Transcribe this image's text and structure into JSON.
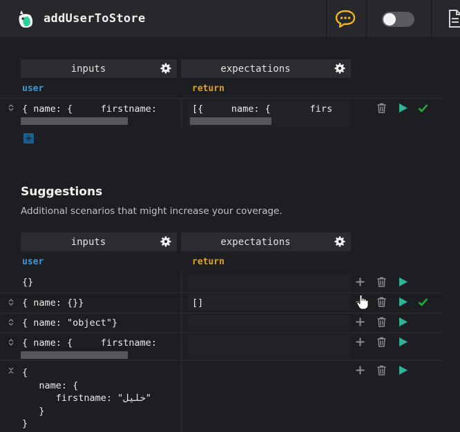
{
  "header": {
    "title": "addUserToStore",
    "icons": [
      "logo-icon",
      "chat-icon",
      "toggle-switch",
      "document-icon"
    ]
  },
  "test": {
    "inputs_label": "inputs",
    "expectations_label": "expectations",
    "input_name": "user",
    "output_name": "return",
    "input_value": "{ name: {     firstname:",
    "output_value": "[{     name: {       firs"
  },
  "suggestions": {
    "title": "Suggestions",
    "subtitle": "Additional scenarios that might increase your coverage.",
    "inputs_label": "inputs",
    "expectations_label": "expectations",
    "input_name": "user",
    "output_name": "return",
    "rows": [
      {
        "input": "{}",
        "output": ""
      },
      {
        "input": "{ name: {}}",
        "output": "[]"
      },
      {
        "input": "{ name: \"object\"}",
        "output": ""
      },
      {
        "input": "{ name: {     firstname:",
        "output": ""
      },
      {
        "input": "{\n   name: {\n      firstname: \"خليل\"\n   }\n}",
        "output": ""
      }
    ]
  },
  "colors": {
    "accent_blue": "#3b9ad9",
    "accent_orange": "#e0a21f",
    "run_green": "#2fb39a",
    "pass_green": "#1fae3c",
    "chat_yellow": "#f2b51b"
  }
}
